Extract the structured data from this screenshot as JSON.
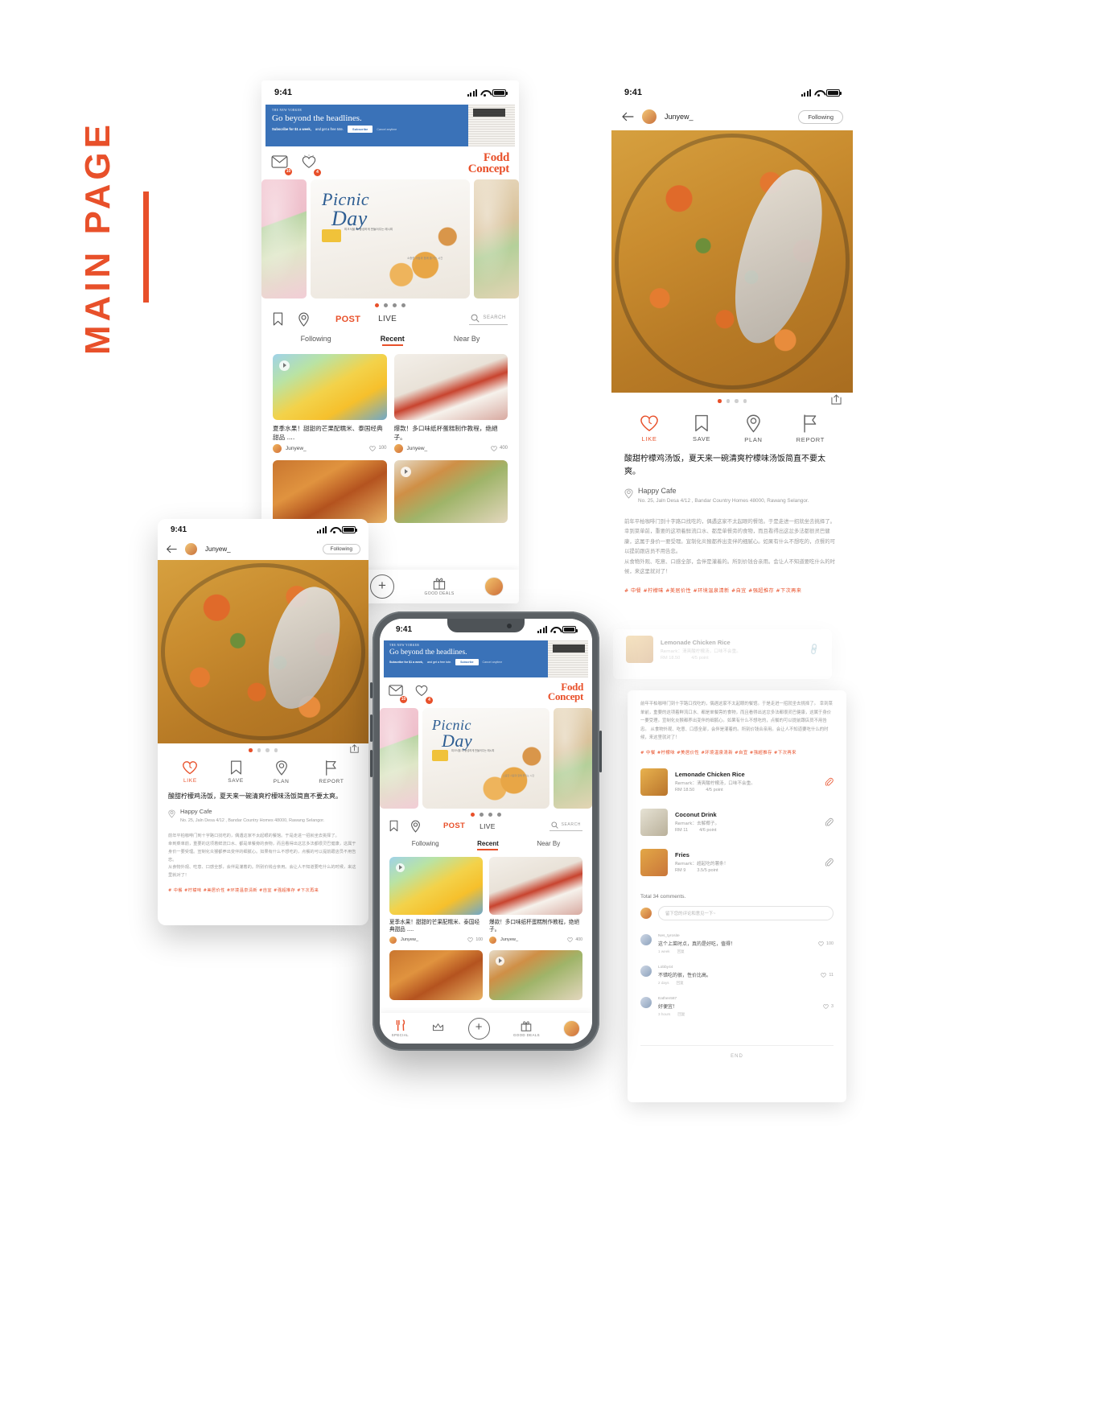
{
  "annotation": {
    "label": "MAIN PAGE"
  },
  "status_bar": {
    "time": "9:41"
  },
  "ad_banner": {
    "kicker": "THE NEW YORKER",
    "headline": "Go beyond the headlines.",
    "subline_bold": "Subscribe for $1 a week,",
    "subline": "and get a free tote.",
    "button": "Subscribe",
    "cancel": "Cancel anytime"
  },
  "app": {
    "logo_line1": "Fodd",
    "logo_line2": "Concept",
    "mail_badge": "10",
    "like_badge": "4",
    "mail_icon": "envelope-icon",
    "like_icon": "heart-icon"
  },
  "carousel": {
    "title_line1": "Picnic",
    "title_line2": "Day",
    "note": "피크닉을 더 풍성하게\n만들어주는 레시피",
    "note2": "소중한 사람과\n함께 즐기는 시간",
    "dots": 4,
    "active_dot": 0
  },
  "action_row": {
    "bookmark_icon": "bookmark-icon",
    "location_icon": "location-pin-icon",
    "post": "POST",
    "live": "LIVE",
    "search_icon": "search-icon",
    "search_label": "SEARCH"
  },
  "tabs": [
    {
      "label": "Following",
      "active": false
    },
    {
      "label": "Recent",
      "active": true
    },
    {
      "label": "Near By",
      "active": false
    }
  ],
  "feed": [
    {
      "caption": "夏季水果！甜甜的芒果配糯米、泰国经典甜品 ....",
      "user": "Junyew_",
      "likes": "100",
      "has_video": true,
      "thumb": "mango-sticky-rice"
    },
    {
      "caption": "爆款！多口味纸杯蛋糕制作教程，绝絕子。",
      "user": "Junyew_",
      "likes": "400",
      "has_video": false,
      "thumb": "cupcakes"
    },
    {
      "caption": "",
      "user": "",
      "likes": "",
      "has_video": false,
      "thumb": "fried-chicken"
    },
    {
      "caption": "",
      "user": "",
      "likes": "",
      "has_video": true,
      "thumb": "pizza-board"
    }
  ],
  "bottom_bar": [
    {
      "label": "SPECIAL",
      "icon": "cutlery-icon"
    },
    {
      "label": "",
      "icon": "crown-icon"
    },
    {
      "label": "",
      "icon": "plus-icon"
    },
    {
      "label": "GOOD DEALS",
      "icon": "gift-icon"
    },
    {
      "label": "",
      "icon": "profile-avatar"
    }
  ],
  "detail": {
    "back_icon": "arrow-left-icon",
    "user": "Junyew_",
    "follow_button": "Following",
    "share_icon": "share-icon",
    "hero_dots": 4,
    "hero_active_dot": 0,
    "actions": [
      {
        "label": "LIKE",
        "icon": "heart-icon",
        "active": true
      },
      {
        "label": "SAVE",
        "icon": "bookmark-icon",
        "active": false
      },
      {
        "label": "PLAN",
        "icon": "location-pin-icon",
        "active": false
      },
      {
        "label": "REPORT",
        "icon": "flag-icon",
        "active": false
      }
    ],
    "title": "酸甜柠檬鸡汤饭，夏天来一碗清爽柠檬味汤饭简直不要太爽。",
    "place_icon": "location-pin-icon",
    "place_name": "Happy Cafe",
    "place_address": "No. 25, Jaln Desa 4/12 , Bandar Country Homes 48000, Rawang Selangor.",
    "body": "前年平柏咖啡门到十字路口找吃的，偶遇这家不太起眼的餐馆。于是走进一招就坐去挑择了。\n幸到菜单前，重要的这项着鲜流口水、都是单餐旁的食物，而且看得出这忿多法都很灵巴健康，这属于身价一要受理。宣制化炎猴都养出变伴的细腻心。如果有什么不想吃的，点餐的可以提前跟店员不用告忠。\n从食物外观、吃意、口感全部，会伴是灌着的。所别价钱合亲用。会让人不知道要吃什么的时候，来这里就对了！",
    "tags": "# 中餐  #柠檬味  #美居价性  #环境温泉清新  #自宜  #强超推存  #下次再来"
  },
  "menu": {
    "items": [
      {
        "name": "Lemonade Chicken Rice",
        "remark": "Remark：清爽酸柠檬汤，口味不会重。",
        "price": "RM 18.50",
        "points": "4/5 point",
        "clip_icon": "paperclip-icon"
      },
      {
        "name": "Coconut Drink",
        "remark": "Remark：去解椰子。",
        "price": "RM 11",
        "points": "4/6 point",
        "clip_icon": "paperclip-icon"
      },
      {
        "name": "Fries",
        "remark": "Remark：超起吃的薯条！",
        "price": "RM 9",
        "points": "3.5/5 point",
        "clip_icon": "paperclip-icon"
      }
    ],
    "total_comments": "Total 34 comments.",
    "comment_placeholder": "留下您的评论和意见一下~",
    "comments": [
      {
        "user": "Nes_tyrosite",
        "text": "这个上菜时点，真的是好吃，值得！",
        "time": "1 week",
        "reply": "回复",
        "likes": "100"
      },
      {
        "user": "Lobby44",
        "text": "不错吃的很，性价比高。",
        "time": "2 days",
        "reply": "回复",
        "likes": "11"
      },
      {
        "user": "Eathen587",
        "text": "好便宜！",
        "time": "3 hours",
        "reply": "回复",
        "likes": "3"
      }
    ],
    "end": "END"
  },
  "colors": {
    "accent": "#E8502A",
    "banner_blue": "#3A72B8",
    "text_dark": "#1d1d1d",
    "text_muted": "#9a9a9a"
  }
}
